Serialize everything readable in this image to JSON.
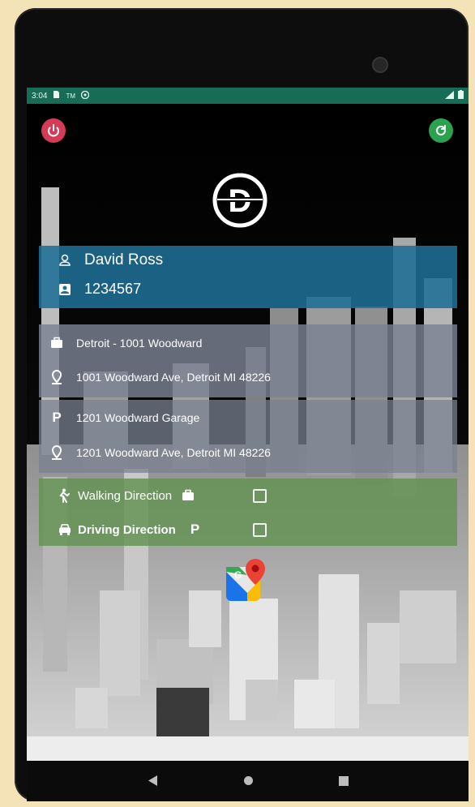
{
  "status_bar": {
    "time": "3:04",
    "icons": [
      "sd-card-icon",
      "tm-icon",
      "chrome-icon"
    ],
    "right_icons": [
      "signal-icon",
      "battery-icon"
    ]
  },
  "top_actions": {
    "power_icon": "power-icon",
    "refresh_icon": "refresh-icon",
    "power_color": "#d33b57",
    "refresh_color": "#2ba24f"
  },
  "logo": {
    "letter": "D"
  },
  "user": {
    "name": "David Ross",
    "id": "1234567"
  },
  "office": {
    "name": "Detroit - 1001 Woodward",
    "address": "1001 Woodward Ave, Detroit MI 48226"
  },
  "garage": {
    "name": "1201 Woodward Garage",
    "address": "1201 Woodward Ave, Detroit MI 48226"
  },
  "directions": {
    "walking_label": "Walking Direction",
    "driving_label": "Driving Direction",
    "walking_checked": false,
    "driving_checked": false
  },
  "navigation": [
    "back-icon",
    "home-icon",
    "recents-icon"
  ]
}
